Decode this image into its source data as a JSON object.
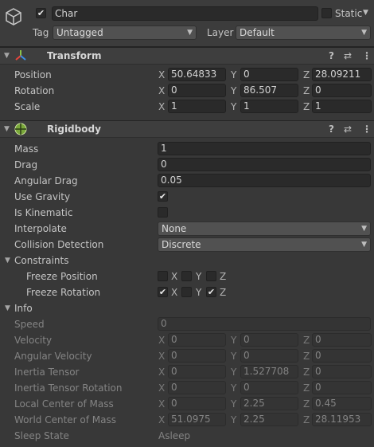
{
  "gameobject": {
    "active": true,
    "name": "Char",
    "static_label": "Static",
    "static": false,
    "tag_label": "Tag",
    "tag_value": "Untagged",
    "layer_label": "Layer",
    "layer_value": "Default"
  },
  "transform": {
    "title": "Transform",
    "rows": [
      {
        "label": "Position",
        "x": "50.64833",
        "y": "0",
        "z": "28.09211"
      },
      {
        "label": "Rotation",
        "x": "0",
        "y": "86.507",
        "z": "0"
      },
      {
        "label": "Scale",
        "x": "1",
        "y": "1",
        "z": "1"
      }
    ]
  },
  "axis": {
    "x": "X",
    "y": "Y",
    "z": "Z"
  },
  "rigidbody": {
    "title": "Rigidbody",
    "mass_label": "Mass",
    "mass": "1",
    "drag_label": "Drag",
    "drag": "0",
    "angular_drag_label": "Angular Drag",
    "angular_drag": "0.05",
    "use_gravity_label": "Use Gravity",
    "use_gravity": true,
    "is_kinematic_label": "Is Kinematic",
    "is_kinematic": false,
    "interpolate_label": "Interpolate",
    "interpolate": "None",
    "collision_label": "Collision Detection",
    "collision": "Discrete",
    "constraints_label": "Constraints",
    "freeze_position_label": "Freeze Position",
    "freeze_position": {
      "x": false,
      "y": false,
      "z": false
    },
    "freeze_rotation_label": "Freeze Rotation",
    "freeze_rotation": {
      "x": true,
      "y": false,
      "z": true
    },
    "info_label": "Info",
    "speed_label": "Speed",
    "speed": "0",
    "info_rows": [
      {
        "label": "Velocity",
        "x": "0",
        "y": "0",
        "z": "0"
      },
      {
        "label": "Angular Velocity",
        "x": "0",
        "y": "0",
        "z": "0"
      },
      {
        "label": "Inertia Tensor",
        "x": "0",
        "y": "1.527708",
        "z": "0"
      },
      {
        "label": "Inertia Tensor Rotation",
        "x": "0",
        "y": "0",
        "z": "0"
      },
      {
        "label": "Local Center of Mass",
        "x": "0",
        "y": "2.25",
        "z": "0.45"
      },
      {
        "label": "World Center of Mass",
        "x": "51.0975",
        "y": "2.25",
        "z": "28.11953"
      }
    ],
    "sleep_label": "Sleep State",
    "sleep": "Asleep"
  },
  "icons": {
    "gameobject": "cube-icon",
    "transform": "transform-axes-icon",
    "rigidbody": "rigidbody-icon",
    "help": "help-icon",
    "presets": "presets-icon",
    "menu": "kebab-menu-icon"
  },
  "colors": {
    "background": "#383838",
    "header": "#3e3e3e",
    "field": "#2a2a2a",
    "text": "#c4c4c4",
    "disabled_text": "#848484"
  }
}
